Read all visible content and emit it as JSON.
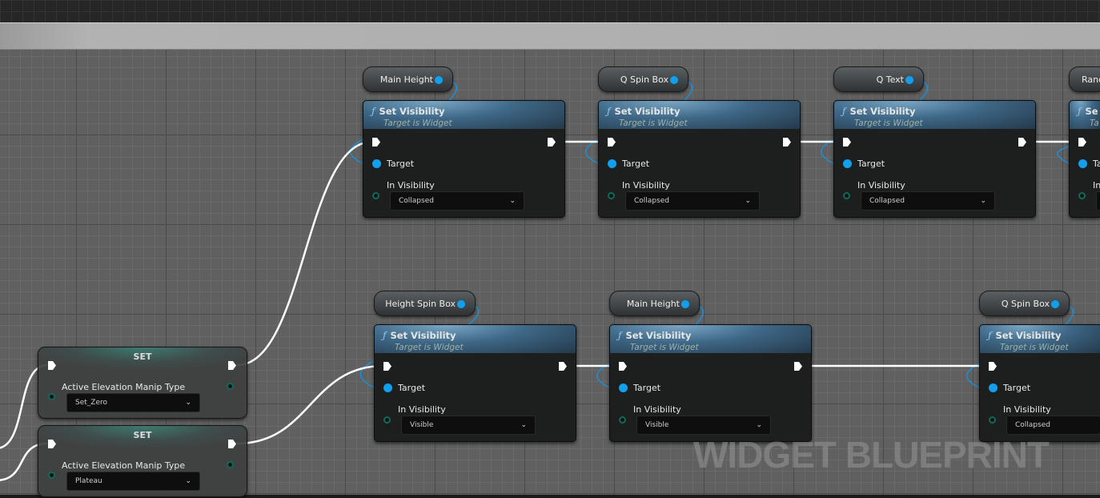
{
  "graph_type_watermark": "WIDGET BLUEPRINT",
  "colors": {
    "exec_wire": "#ffffff",
    "object_pin": "#10a0f0",
    "function_header": "#3e6786",
    "enum_pin": "#0f6a5c"
  },
  "set_nodes": [
    {
      "title": "SET",
      "variable": "Active Elevation Manip Type",
      "value": "Set_Zero"
    },
    {
      "title": "SET",
      "variable": "Active Elevation Manip Type",
      "value": "Plateau"
    }
  ],
  "function_nodes": [
    {
      "target_var": "Main Height",
      "title": "Set Visibility",
      "subtitle": "Target is Widget",
      "target_label": "Target",
      "param_label": "In Visibility",
      "value": "Collapsed"
    },
    {
      "target_var": "Q Spin Box",
      "title": "Set Visibility",
      "subtitle": "Target is Widget",
      "target_label": "Target",
      "param_label": "In Visibility",
      "value": "Collapsed"
    },
    {
      "target_var": "Q Text",
      "title": "Set Visibility",
      "subtitle": "Target is Widget",
      "target_label": "Target",
      "param_label": "In Visibility",
      "value": "Collapsed"
    },
    {
      "target_var": "Rand",
      "title": "Se",
      "subtitle": "Ta",
      "target_label": "Ta",
      "param_label": "In",
      "value": ""
    },
    {
      "target_var": "Height Spin Box",
      "title": "Set Visibility",
      "subtitle": "Target is Widget",
      "target_label": "Target",
      "param_label": "In Visibility",
      "value": "Visible"
    },
    {
      "target_var": "Main Height",
      "title": "Set Visibility",
      "subtitle": "Target is Widget",
      "target_label": "Target",
      "param_label": "In Visibility",
      "value": "Visible"
    },
    {
      "target_var": "Q Spin Box",
      "title": "Set Visibility",
      "subtitle": "Target is Widget",
      "target_label": "Target",
      "param_label": "In Visibility",
      "value": "Collapsed"
    }
  ]
}
